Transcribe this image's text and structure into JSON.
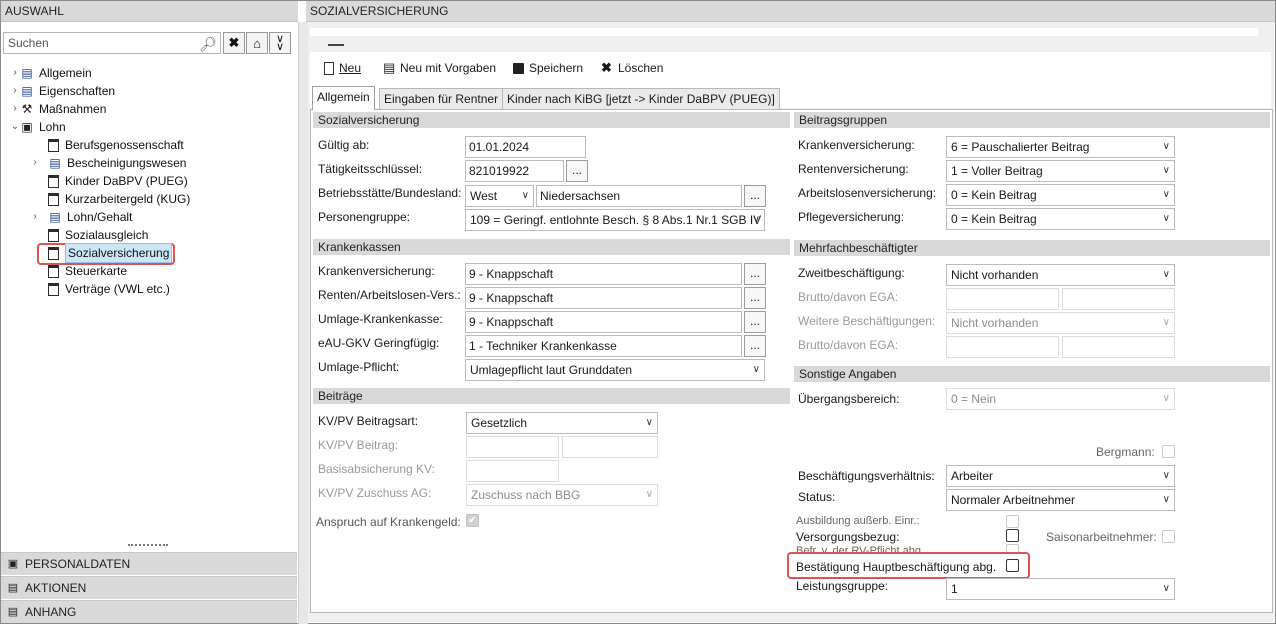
{
  "left": {
    "header": "AUSWAHL",
    "search_placeholder": "Suchen",
    "tree": [
      {
        "label": "Allgemein"
      },
      {
        "label": "Eigenschaften"
      },
      {
        "label": "Maßnahmen"
      },
      {
        "label": "Lohn"
      },
      {
        "label": "Berufsgenossenschaft"
      },
      {
        "label": "Bescheinigungswesen"
      },
      {
        "label": "Kinder DaBPV (PUEG)"
      },
      {
        "label": "Kurzarbeitergeld (KUG)"
      },
      {
        "label": "Lohn/Gehalt"
      },
      {
        "label": "Sozialausgleich"
      },
      {
        "label": "Sozialversicherung"
      },
      {
        "label": "Steuerkarte"
      },
      {
        "label": "Verträge (VWL etc.)"
      }
    ],
    "accordion": [
      "PERSONALDATEN",
      "AKTIONEN",
      "ANHANG"
    ]
  },
  "right": {
    "header": "SOZIALVERSICHERUNG",
    "toolbar": {
      "new": "Neu",
      "new_defaults": "Neu mit Vorgaben",
      "save": "Speichern",
      "delete": "Löschen"
    },
    "tabs": [
      "Allgemein",
      "Eingaben für Rentner",
      "Kinder nach KiBG [jetzt -> Kinder DaBPV (PUEG)]"
    ]
  },
  "sv": {
    "title": "Sozialversicherung",
    "gueltig_label": "Gültig ab:",
    "gueltig": "01.01.2024",
    "taetig_label": "Tätigkeitsschlüssel:",
    "taetig": "821019922",
    "betrieb_label": "Betriebsstätte/Bundesland:",
    "betrieb_west": "West",
    "betrieb_land": "Niedersachsen",
    "personen_label": "Personengruppe:",
    "personen": "109 = Geringf. entlohnte Besch. § 8 Abs.1 Nr.1 SGB IV"
  },
  "kk": {
    "title": "Krankenkassen",
    "kv_label": "Krankenversicherung:",
    "kv": "9 - Knappschaft",
    "rv_label": "Renten/Arbeitslosen-Vers.:",
    "rv": "9 - Knappschaft",
    "umlage_label": "Umlage-Krankenkasse:",
    "umlage": "9 - Knappschaft",
    "eau_label": "eAU-GKV Geringfügig:",
    "eau": "1 - Techniker Krankenkasse",
    "umlpf_label": "Umlage-Pflicht:",
    "umlpf": "Umlagepflicht laut Grunddaten"
  },
  "beitraege": {
    "title": "Beiträge",
    "art_label": "KV/PV Beitragsart:",
    "art": "Gesetzlich",
    "beitrag_label": "KV/PV Beitrag:",
    "basis_label": "Basisabsicherung KV:",
    "zuschuss_label": "KV/PV Zuschuss AG:",
    "zuschuss": "Zuschuss nach BBG",
    "anspruch_label": "Anspruch auf Krankengeld:"
  },
  "bg": {
    "title": "Beitragsgruppen",
    "kv_label": "Krankenversicherung:",
    "kv": "6 = Pauschalierter Beitrag",
    "rv_label": "Rentenversicherung:",
    "rv": "1 = Voller Beitrag",
    "av_label": "Arbeitslosenversicherung:",
    "av": "0 = Kein Beitrag",
    "pv_label": "Pflegeversicherung:",
    "pv": "0 = Kein Beitrag"
  },
  "mehr": {
    "title": "Mehrfachbeschäftigter",
    "zweit_label": "Zweitbeschäftigung:",
    "zweit": "Nicht vorhanden",
    "brutto_label": "Brutto/davon EGA:",
    "weitere_label": "Weitere Beschäftigungen:",
    "weitere": "Nicht vorhanden",
    "brutto2_label": "Brutto/davon EGA:"
  },
  "sonst": {
    "title": "Sonstige Angaben",
    "ueber_label": "Übergangsbereich:",
    "ueber": "0 = Nein",
    "bergmann_label": "Bergmann:",
    "verh_label": "Beschäftigungsverhältnis:",
    "verh": "Arbeiter",
    "status_label": "Status:",
    "status": "Normaler Arbeitnehmer",
    "ausb_label": "Ausbildung außerb. Einr.:",
    "versorg_label": "Versorgungsbezug:",
    "saison_label": "Saisonarbeitnehmer:",
    "befr_label": "Befr. v. der RV-Pflicht abg.",
    "haupt_label": "Bestätigung Hauptbeschäftigung abg.",
    "leist_label": "Leistungsgruppe:",
    "leist": "1"
  }
}
